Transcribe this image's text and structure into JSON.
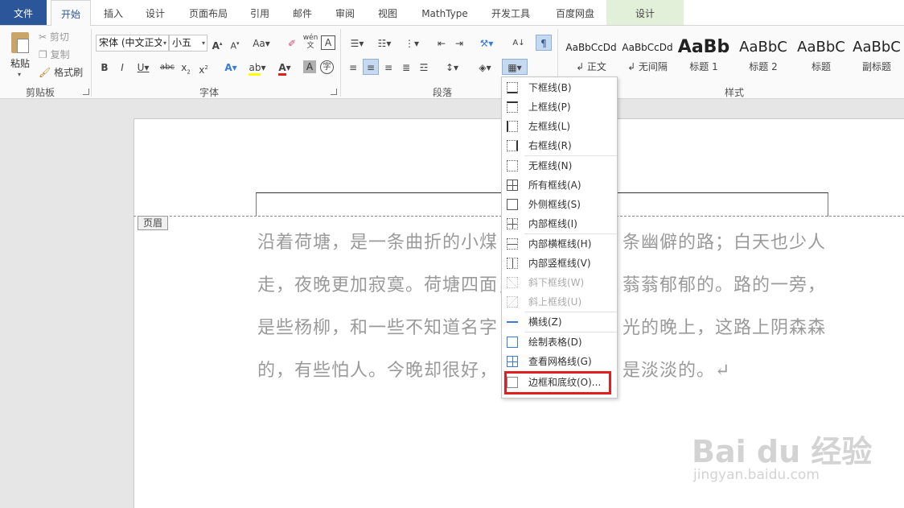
{
  "tabs": [
    "文件",
    "开始",
    "插入",
    "设计",
    "页面布局",
    "引用",
    "邮件",
    "审阅",
    "视图",
    "MathType",
    "开发工具",
    "百度网盘",
    "设计"
  ],
  "clipboard": {
    "paste": "粘贴",
    "cut": "剪切",
    "copy": "复制",
    "format_painter": "格式刷",
    "group": "剪贴板"
  },
  "font": {
    "family": "宋体 (中文正文)",
    "size": "小五",
    "group": "字体"
  },
  "paragraph": {
    "group": "段落"
  },
  "styles": {
    "group": "样式",
    "items": [
      {
        "sample": "AaBbCcDd",
        "name": "↲ 正文"
      },
      {
        "sample": "AaBbCcDd",
        "name": "↲ 无间隔"
      },
      {
        "sample": "AaBb",
        "name": "标题 1"
      },
      {
        "sample": "AaBbC",
        "name": "标题 2"
      },
      {
        "sample": "AaBbC",
        "name": "标题"
      },
      {
        "sample": "AaBbC",
        "name": "副标题"
      }
    ]
  },
  "document": {
    "header_tag": "页眉",
    "lines": [
      "沿着荷塘，是一条曲折的小煤",
      "条幽僻的路；白天也少人",
      "走，夜晚更加寂寞。荷塘四面，",
      "蓊蓊郁郁的。路的一旁，",
      "是些杨柳，和一些不知道名字",
      "光的晚上，这路上阴森森",
      "的，有些怕人。今晚却很好，",
      "是淡淡的。↵"
    ]
  },
  "menu": {
    "items": [
      {
        "label": "下框线(B)",
        "disabled": false
      },
      {
        "label": "上框线(P)",
        "disabled": false
      },
      {
        "label": "左框线(L)",
        "disabled": false
      },
      {
        "label": "右框线(R)",
        "disabled": false
      },
      {
        "label": "无框线(N)",
        "disabled": false
      },
      {
        "label": "所有框线(A)",
        "disabled": false
      },
      {
        "label": "外侧框线(S)",
        "disabled": false
      },
      {
        "label": "内部框线(I)",
        "disabled": false
      },
      {
        "label": "内部横框线(H)",
        "disabled": false
      },
      {
        "label": "内部竖框线(V)",
        "disabled": false
      },
      {
        "label": "斜下框线(W)",
        "disabled": true
      },
      {
        "label": "斜上框线(U)",
        "disabled": true
      },
      {
        "label": "横线(Z)",
        "disabled": false
      },
      {
        "label": "绘制表格(D)",
        "disabled": false
      },
      {
        "label": "查看网格线(G)",
        "disabled": false
      },
      {
        "label": "边框和底纹(O)...",
        "disabled": false
      }
    ]
  },
  "watermark": {
    "brand": "Bai du 经验",
    "url": "jingyan.baidu.com"
  }
}
